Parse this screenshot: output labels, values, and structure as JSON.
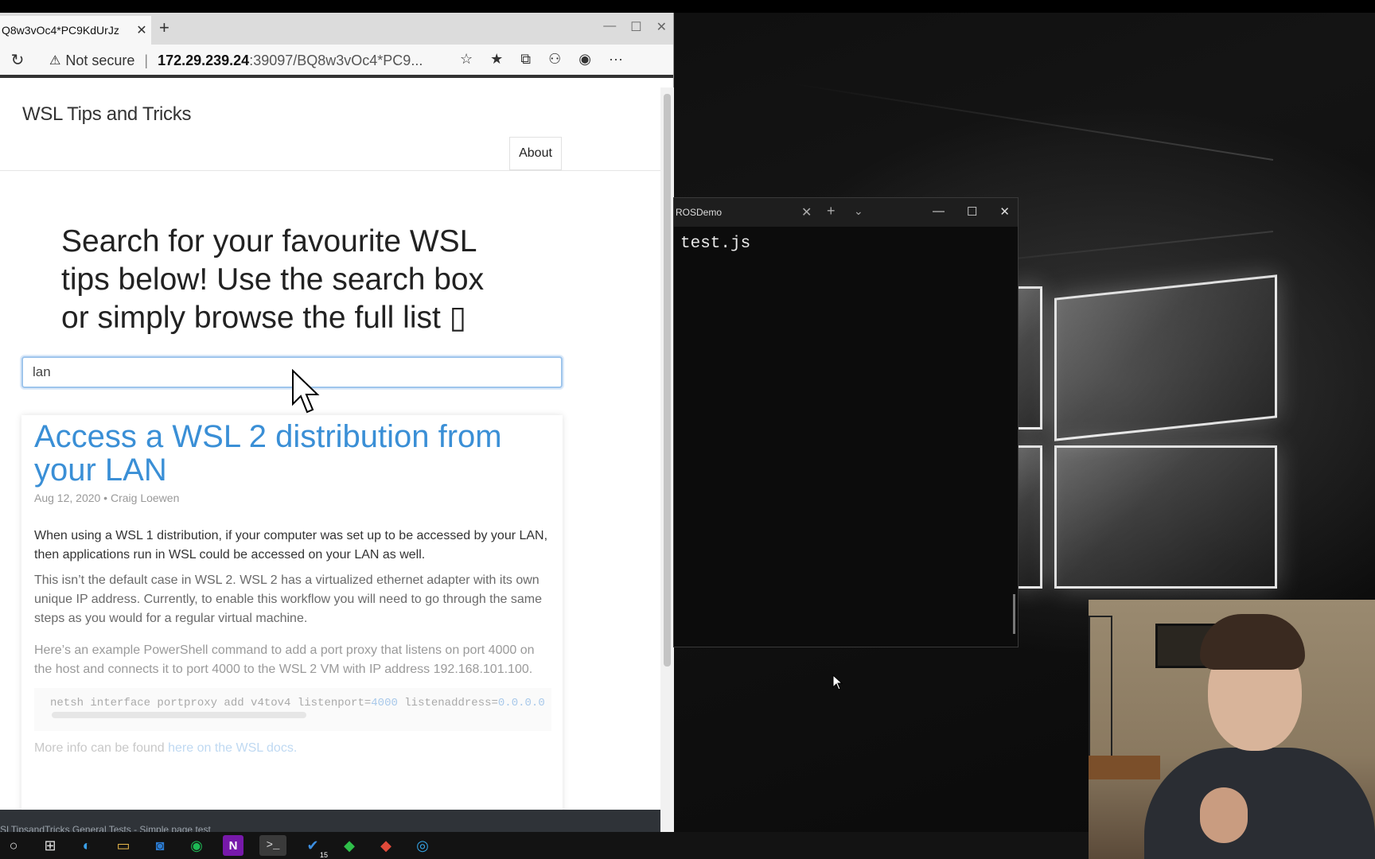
{
  "browser": {
    "tab_title": "Q8w3vOc4*PC9KdUrJz",
    "tab_close": "✕",
    "new_tab": "+",
    "window_controls": {
      "minimize": "—",
      "maximize": "☐",
      "close": "✕"
    },
    "reload_icon": "↻",
    "warning_icon": "⚠",
    "security_label": "Not secure",
    "separator": "|",
    "url_host": "172.29.239.24",
    "url_path": ":39097/BQ8w3vOc4*PC9...",
    "toolbar_icons": [
      "☆",
      "★",
      "⧉",
      "⚇",
      "◉",
      "···"
    ]
  },
  "site": {
    "title": "WSL Tips and Tricks",
    "nav_about": "About",
    "hero": "Search for your favourite WSL tips below! Use the search box or simply browse the full list ▯",
    "search_value": "lan"
  },
  "post": {
    "title": "Access a WSL 2 distribution from your LAN",
    "meta": "Aug 12, 2020 • Craig Loewen",
    "p1": "When using a WSL 1 distribution, if your computer was set up to be accessed by your LAN, then applications run in WSL could be accessed on your LAN as well.",
    "p2": "This isn’t the default case in WSL 2. WSL 2 has a virtualized ethernet adapter with its own unique IP address. Currently, to enable this workflow you will need to go through the same steps as you would for a regular virtual machine.",
    "p3": "Here’s an example PowerShell command to add a port proxy that listens on port 4000 on the host and connects it to port 4000 to the WSL 2 VM with IP address 192.168.101.100.",
    "code_prefix": "netsh interface portproxy add v4tov4 listenport=",
    "code_port": "4000",
    "code_mid": " listenaddress=",
    "code_addr": "0.0.0.0",
    "more_prefix": "More info can be found ",
    "more_link": "here on the WSL docs."
  },
  "status_text": "SLTipsandTricks General Tests - Simple page test",
  "terminal": {
    "tab_title": "ROSDemo",
    "tab_close": "✕",
    "new_tab": "+",
    "dropdown": "⌄",
    "window_controls": {
      "minimize": "—",
      "maximize": "☐",
      "close": "✕"
    },
    "text": "test.js"
  },
  "taskbar": {
    "icons": [
      "○",
      "⊞",
      "◐",
      "▭",
      "◙",
      "◉",
      "N",
      ">_",
      "✔",
      "◆",
      "◆",
      "◎"
    ],
    "badge": "15"
  }
}
